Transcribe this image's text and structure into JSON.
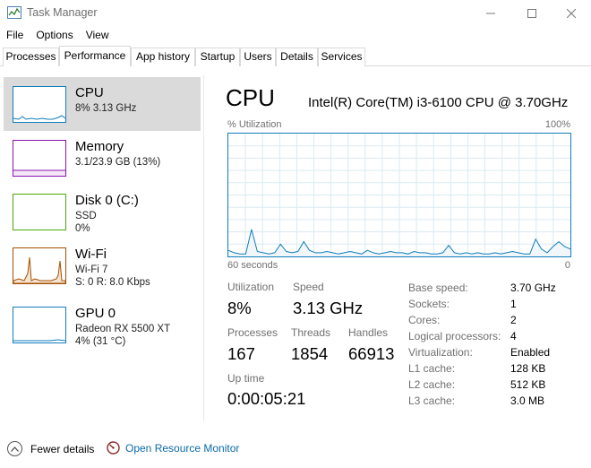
{
  "window": {
    "title": "Task Manager"
  },
  "menu": [
    "File",
    "Options",
    "View"
  ],
  "tabs": [
    "Processes",
    "Performance",
    "App history",
    "Startup",
    "Users",
    "Details",
    "Services"
  ],
  "active_tab": "Performance",
  "sidebar": {
    "items": [
      {
        "name": "CPU",
        "lines": [
          "8%  3.13 GHz"
        ],
        "color": "#117dbb"
      },
      {
        "name": "Memory",
        "lines": [
          "3.1/23.9 GB (13%)"
        ],
        "color": "#8b12ae"
      },
      {
        "name": "Disk 0 (C:)",
        "lines": [
          "SSD",
          "0%"
        ],
        "color": "#4da60c"
      },
      {
        "name": "Wi-Fi",
        "lines": [
          "Wi-Fi 7",
          "S: 0  R: 8.0 Kbps"
        ],
        "color": "#a74f01"
      },
      {
        "name": "GPU 0",
        "lines": [
          "Radeon RX 5500 XT",
          "4% (31 °C)"
        ],
        "color": "#117dbb"
      }
    ]
  },
  "detail": {
    "title": "CPU",
    "model": "Intel(R) Core(TM) i3-6100 CPU @ 3.70GHz",
    "graph_label": "% Utilization",
    "graph_max": "100%",
    "graph_time": "60 seconds",
    "graph_min": "0",
    "utilization_series": [
      5,
      3,
      2,
      2,
      22,
      4,
      3,
      2,
      3,
      10,
      4,
      3,
      4,
      12,
      5,
      3,
      3,
      4,
      3,
      2,
      3,
      4,
      3,
      2,
      5,
      3,
      2,
      3,
      4,
      3,
      3,
      2,
      4,
      3,
      3,
      2,
      2,
      3,
      9,
      3,
      2,
      3,
      2,
      3,
      2,
      2,
      3,
      2,
      3,
      4,
      3,
      2,
      2,
      14,
      6,
      3,
      8,
      12,
      8,
      6
    ],
    "stats": {
      "utilization_label": "Utilization",
      "utilization": "8%",
      "speed_label": "Speed",
      "speed": "3.13 GHz",
      "processes_label": "Processes",
      "processes": "167",
      "threads_label": "Threads",
      "threads": "1854",
      "handles_label": "Handles",
      "handles": "66913",
      "uptime_label": "Up time",
      "uptime": "0:00:05:21"
    },
    "info": [
      {
        "label": "Base speed:",
        "value": "3.70 GHz"
      },
      {
        "label": "Sockets:",
        "value": "1"
      },
      {
        "label": "Cores:",
        "value": "2"
      },
      {
        "label": "Logical processors:",
        "value": "4"
      },
      {
        "label": "Virtualization:",
        "value": "Enabled"
      },
      {
        "label": "L1 cache:",
        "value": "128 KB"
      },
      {
        "label": "L2 cache:",
        "value": "512 KB"
      },
      {
        "label": "L3 cache:",
        "value": "3.0 MB"
      }
    ]
  },
  "footer": {
    "fewer_details": "Fewer details",
    "open_resource_monitor": "Open Resource Monitor"
  },
  "colors": {
    "cpu": "#117dbb",
    "memory": "#8b12ae",
    "disk": "#4da60c",
    "wifi": "#a74f01",
    "link": "#0a6aa8"
  }
}
